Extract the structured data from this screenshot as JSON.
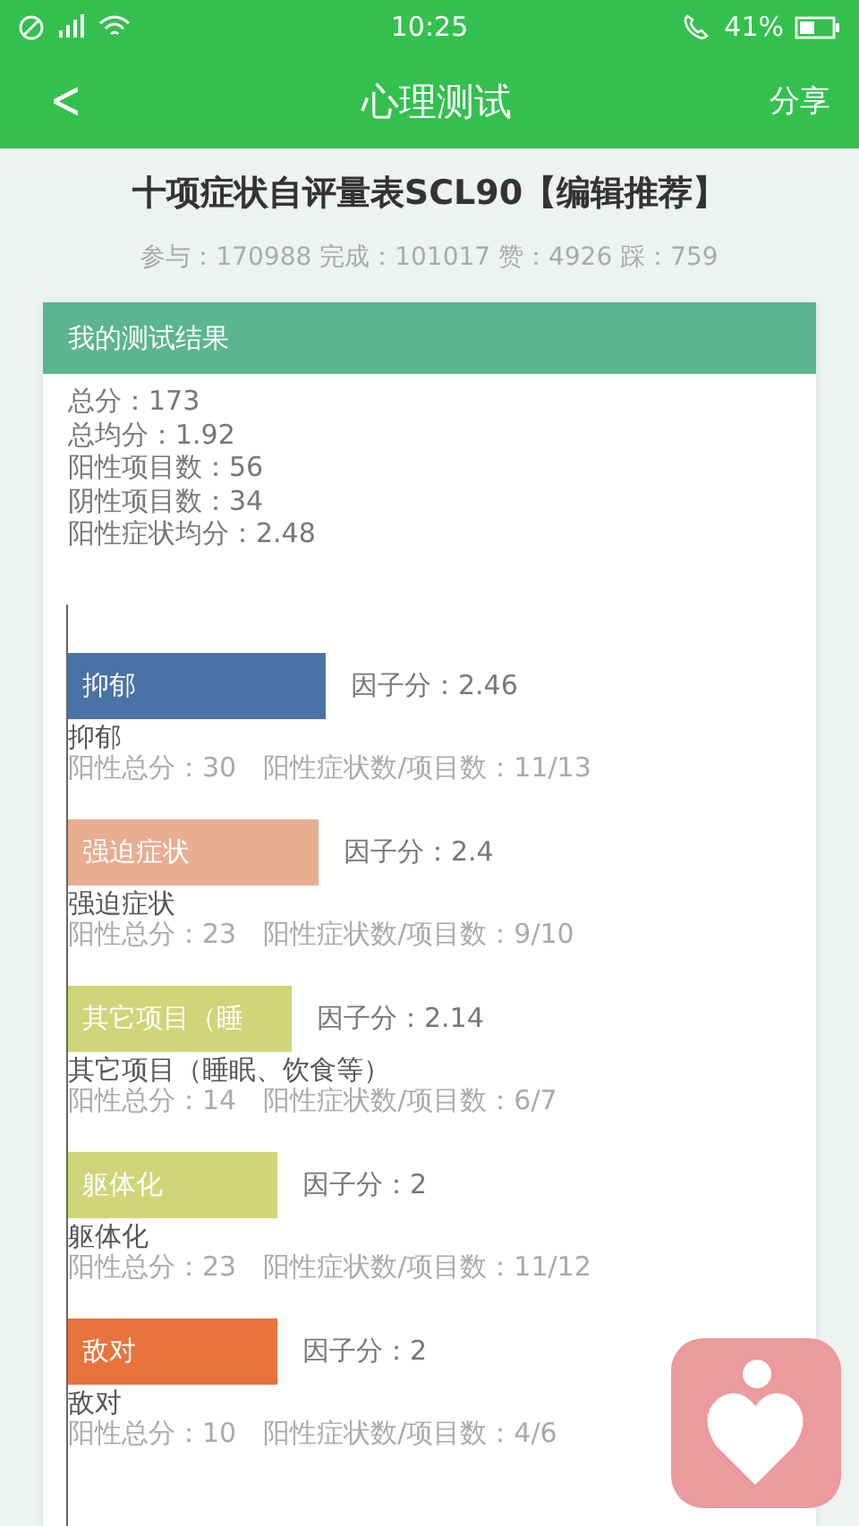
{
  "status_bar": {
    "time": "10:25",
    "battery": "41%"
  },
  "header": {
    "back": "<",
    "title": "心理测试",
    "action": "分享"
  },
  "test": {
    "title": "十项症状自评量表SCL90【编辑推荐】",
    "stats": "参与：170988 完成：101017 赞：4926 踩：759"
  },
  "result_card": {
    "title": "我的测试结果",
    "summary": [
      "总分：173",
      "总均分：1.92",
      "阳性项目数：56",
      "阴性项目数：34",
      "阳性症状均分：2.48"
    ],
    "factors": [
      {
        "bar_label": "抑郁",
        "color": "#4a72a6",
        "score": "因子分：2.46",
        "name": "抑郁",
        "positive_total": "阳性总分：30",
        "ratio": "阳性症状数/项目数：11/13"
      },
      {
        "bar_label": "强迫症状",
        "color": "#e9ad92",
        "score": "因子分：2.4",
        "name": "强迫症状",
        "positive_total": "阳性总分：23",
        "ratio": "阳性症状数/项目数：9/10"
      },
      {
        "bar_label": "其它项目（睡",
        "color": "#d0d579",
        "score": "因子分：2.14",
        "name": "其它项目（睡眠、饮食等）",
        "positive_total": "阳性总分：14",
        "ratio": "阳性症状数/项目数：6/7"
      },
      {
        "bar_label": "躯体化",
        "color": "#d0d579",
        "score": "因子分：2",
        "name": "躯体化",
        "positive_total": "阳性总分：23",
        "ratio": "阳性症状数/项目数：11/12"
      },
      {
        "bar_label": "敌对",
        "color": "#e8733c",
        "score": "因子分：2",
        "name": "敌对",
        "positive_total": "阳性总分：10",
        "ratio": "阳性症状数/项目数：4/6"
      }
    ]
  }
}
